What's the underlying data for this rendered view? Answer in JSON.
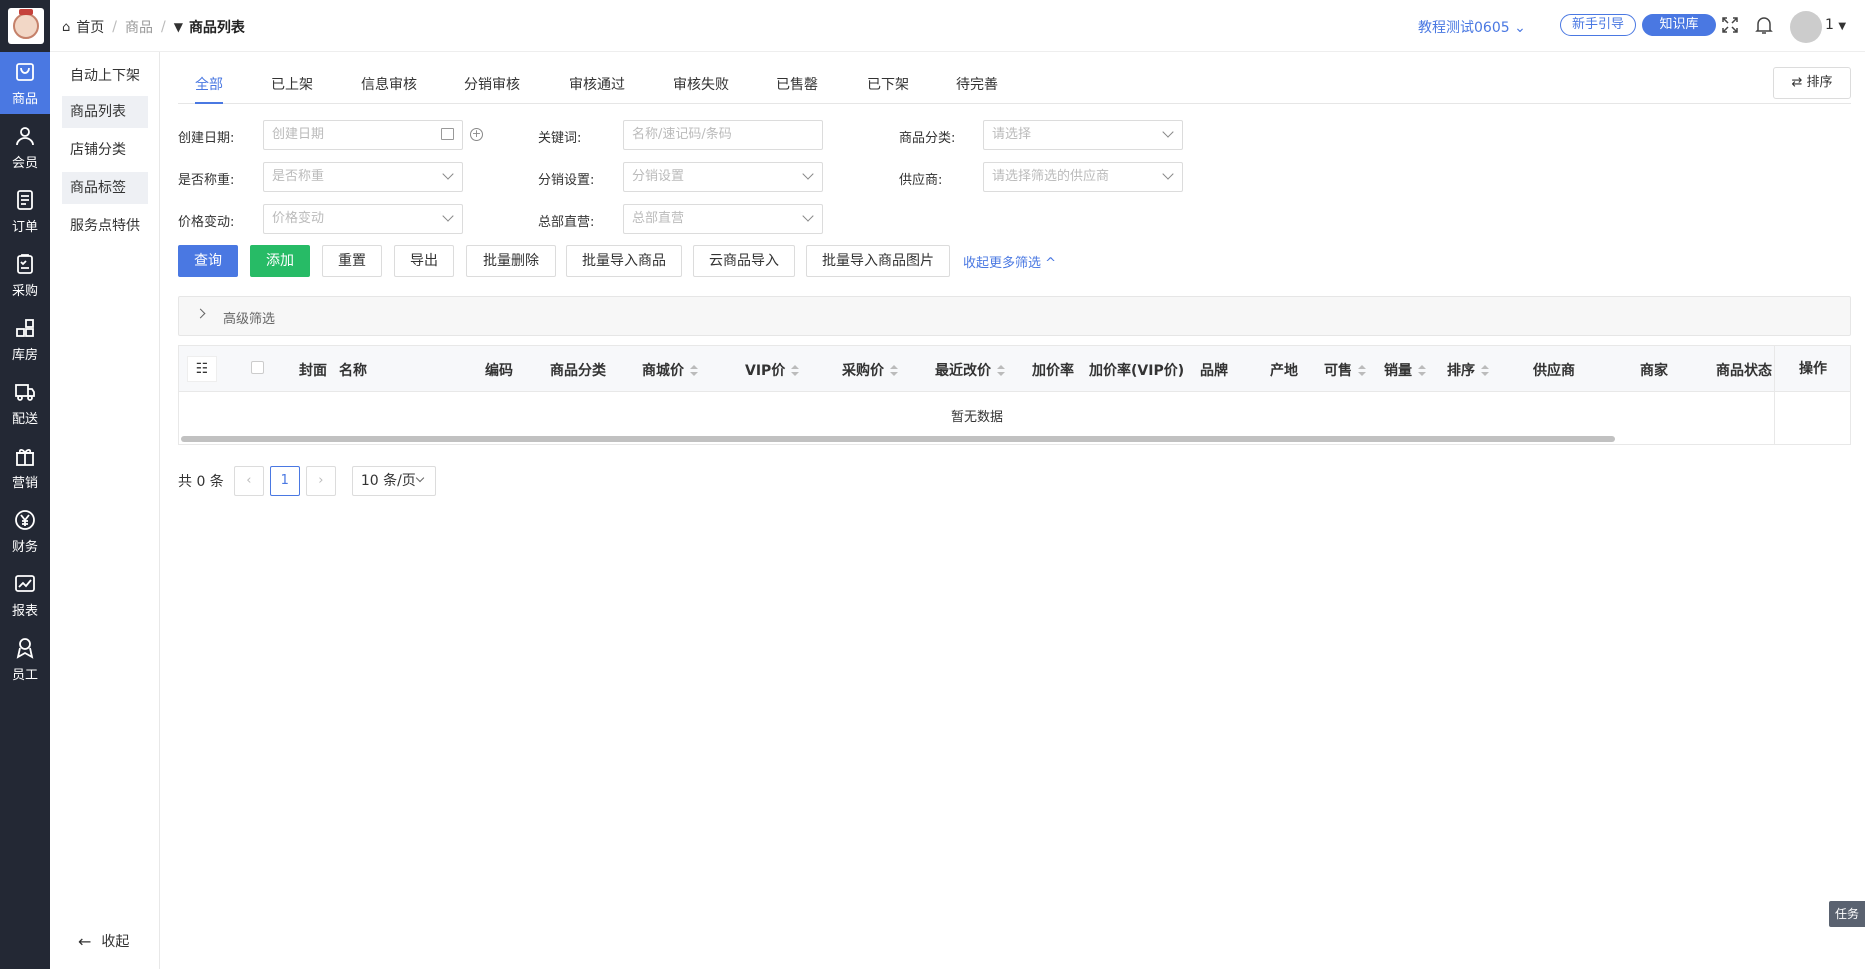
{
  "nav": {
    "items": [
      {
        "label": "商品",
        "icon": "bag-icon"
      },
      {
        "label": "会员",
        "icon": "user-icon"
      },
      {
        "label": "订单",
        "icon": "document-icon"
      },
      {
        "label": "采购",
        "icon": "clipboard-icon"
      },
      {
        "label": "库房",
        "icon": "grid-icon"
      },
      {
        "label": "配送",
        "icon": "truck-icon"
      },
      {
        "label": "营销",
        "icon": "gift-icon"
      },
      {
        "label": "财务",
        "icon": "yen-icon"
      },
      {
        "label": "报表",
        "icon": "chart-icon"
      },
      {
        "label": "员工",
        "icon": "staff-icon"
      }
    ]
  },
  "submenu": {
    "items": [
      "自动上下架",
      "商品列表",
      "店铺分类",
      "商品标签",
      "服务点特供"
    ],
    "collapse_label": "收起"
  },
  "header": {
    "breadcrumb": {
      "home": "首页",
      "parent": "商品",
      "current": "商品列表"
    },
    "store_name": "教程测试0605",
    "guide_label": "新手引导",
    "kb_label": "知识库",
    "user_name": "1"
  },
  "tabs": [
    "全部",
    "已上架",
    "信息审核",
    "分销审核",
    "审核通过",
    "审核失败",
    "已售罄",
    "已下架",
    "待完善"
  ],
  "sort_label": "⇄ 排序",
  "filters": {
    "create_date": {
      "label": "创建日期:",
      "placeholder": "创建日期"
    },
    "keyword": {
      "label": "关键词:",
      "placeholder": "名称/速记码/条码"
    },
    "category": {
      "label": "商品分类:",
      "placeholder": "请选择"
    },
    "weighing": {
      "label": "是否称重:",
      "placeholder": "是否称重"
    },
    "distribution": {
      "label": "分销设置:",
      "placeholder": "分销设置"
    },
    "supplier": {
      "label": "供应商:",
      "placeholder": "请选择筛选的供应商"
    },
    "price_change": {
      "label": "价格变动:",
      "placeholder": "价格变动"
    },
    "hq_direct": {
      "label": "总部直营:",
      "placeholder": "总部直营"
    }
  },
  "actions": {
    "query": "查询",
    "add": "添加",
    "reset": "重置",
    "export": "导出",
    "batch_delete": "批量删除",
    "batch_import": "批量导入商品",
    "cloud_import": "云商品导入",
    "batch_import_images": "批量导入商品图片",
    "collapse_filters": "收起更多筛选 ^"
  },
  "advanced_filter_label": "高级筛选",
  "table": {
    "column_settings_glyph": "☷",
    "columns": [
      "封面",
      "名称",
      "编码",
      "商品分类",
      "商城价",
      "VIP价",
      "采购价",
      "最近改价",
      "加价率",
      "加价率(VIP价)",
      "品牌",
      "产地",
      "可售",
      "销量",
      "排序",
      "供应商",
      "商家",
      "商品状态"
    ],
    "op_column": "操作",
    "empty_text": "暂无数据"
  },
  "pagination": {
    "total": "共 0 条",
    "prev": "‹",
    "current": "1",
    "next": "›",
    "page_size": "10 条/页"
  },
  "task_label": "任务",
  "colors": {
    "primary": "#4a78e2",
    "success": "#27bb66",
    "sidebar": "#232834"
  }
}
